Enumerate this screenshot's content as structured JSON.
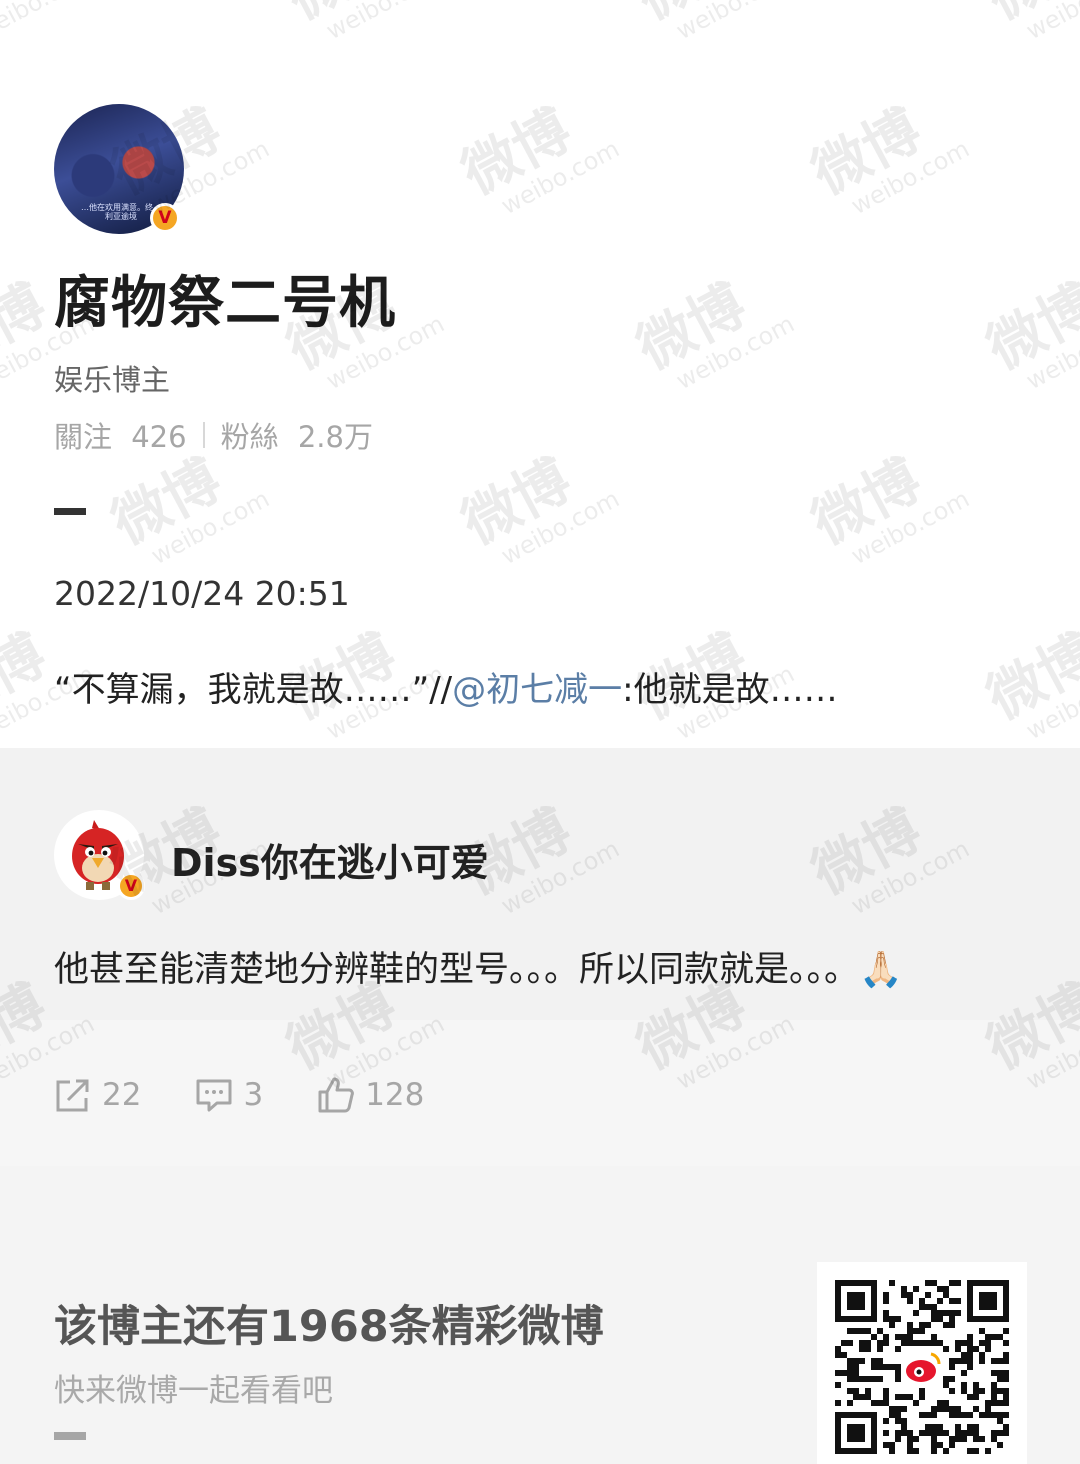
{
  "profile": {
    "avatar_caption": "…他在欢用满意。终…\n利亚逾境",
    "name": "腐物祭二号机",
    "role": "娱乐博主",
    "following_label": "關注",
    "following_count": "426",
    "followers_label": "粉絲",
    "followers_count": "2.8万"
  },
  "post": {
    "date": "2022/10/24 20:51",
    "quote_before": "“不算漏，我就是故……”//",
    "mention": "@初七减一",
    "quote_after": ":他就是故……"
  },
  "repost": {
    "author": "Diss你在逃小可爱",
    "content": "他甚至能清楚地分辨鞋的型号。。。所以同款就是。。。🙏🏻"
  },
  "actions": {
    "share_count": "22",
    "comment_count": "3",
    "like_count": "128"
  },
  "footer": {
    "cta_title": "该博主还有1968条精彩微博",
    "cta_subtitle": "快来微博一起看看吧"
  },
  "watermark": {
    "text": "微博",
    "domain": "weibo.com"
  },
  "colors": {
    "mention": "#5b7ea6",
    "verified_badge": "#f5a623",
    "verified_mark": "#d0021b"
  }
}
